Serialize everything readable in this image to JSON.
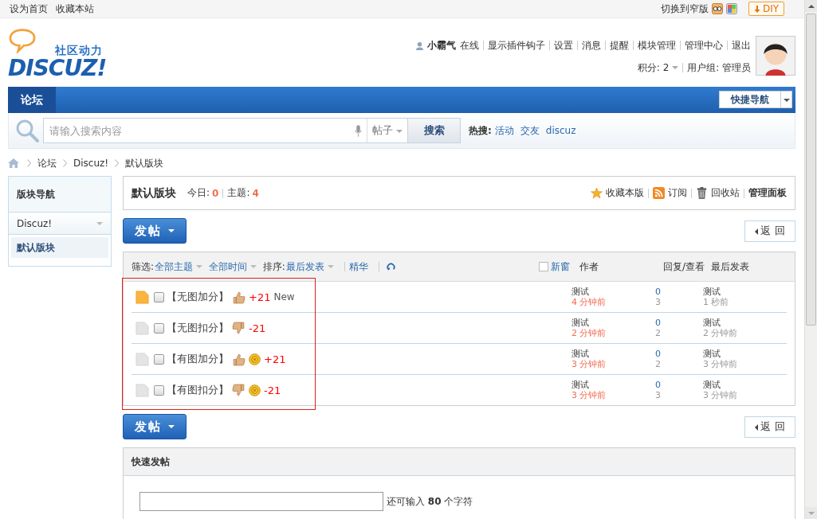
{
  "topbar": {
    "links": [
      "设为首页",
      "收藏本站"
    ],
    "switch_label": "切换到窄版",
    "diy": "DIY"
  },
  "logo": {
    "tagline": "社区动力",
    "wordmark": "DISCUZ!"
  },
  "user": {
    "name": "小霸气",
    "status": "在线",
    "links": [
      "显示插件钩子",
      "设置",
      "消息",
      "提醒",
      "模块管理",
      "管理中心",
      "退出"
    ],
    "points": "积分: 2",
    "group": "用户组: 管理员"
  },
  "nav": {
    "tabs": [
      {
        "label": "论坛",
        "selected": true
      }
    ],
    "quick_nav": "快捷导航"
  },
  "search": {
    "placeholder": "请输入搜索内容",
    "type": "帖子",
    "button": "搜索",
    "hot_label": "热搜:",
    "hot": [
      "活动",
      "交友",
      "discuz"
    ]
  },
  "breadcrumb": [
    "论坛",
    "Discuz!",
    "默认版块"
  ],
  "sidebar": {
    "title": "版块导航",
    "groups": [
      {
        "label": "Discuz!",
        "expanded": true,
        "items": [
          {
            "label": "默认版块",
            "selected": true
          }
        ]
      }
    ]
  },
  "forum": {
    "title": "默认版块",
    "today_label": "今日:",
    "today": "0",
    "topics_label": "主题:",
    "topics": "4",
    "actions": [
      {
        "kind": "star",
        "label": "收藏本版"
      },
      {
        "kind": "rss",
        "label": "订阅"
      },
      {
        "kind": "trash",
        "label": "回收站"
      },
      {
        "kind": "text",
        "label": "管理面板"
      }
    ]
  },
  "toolbars": [
    {
      "post": "发帖",
      "back": "返 回"
    },
    {
      "post": "发帖",
      "back": "返 回"
    }
  ],
  "filter": {
    "label": "筛选:",
    "filters": [
      "全部主题",
      "全部时间"
    ],
    "sort_label": "排序:",
    "sort": "最后发表",
    "digest": "精华",
    "new_window": {
      "label": "新窗",
      "checked": false
    },
    "columns": [
      "作者",
      "回复/查看",
      "最后发表"
    ]
  },
  "threads": [
    {
      "new": true,
      "checked": false,
      "title": "【无图加分】",
      "kind": "up",
      "coin": false,
      "score": "+21",
      "badge": "New",
      "author": "测试",
      "author_time": "4 分钟前",
      "replies": "0",
      "views": "3",
      "last_user": "测试",
      "last_time": "1 秒前"
    },
    {
      "new": false,
      "checked": false,
      "title": "【无图扣分】",
      "kind": "down",
      "coin": false,
      "score": "-21",
      "author": "测试",
      "author_time": "2 分钟前",
      "replies": "0",
      "views": "2",
      "last_user": "测试",
      "last_time": "2 分钟前"
    },
    {
      "new": false,
      "checked": false,
      "title": "【有图加分】",
      "kind": "up",
      "coin": true,
      "score": "+21",
      "author": "测试",
      "author_time": "3 分钟前",
      "replies": "0",
      "views": "2",
      "last_user": "测试",
      "last_time": "3 分钟前"
    },
    {
      "new": false,
      "checked": false,
      "title": "【有图扣分】",
      "kind": "down",
      "coin": true,
      "score": "-21",
      "author": "测试",
      "author_time": "3 分钟前",
      "replies": "0",
      "views": "3",
      "last_user": "测试",
      "last_time": "3 分钟前"
    }
  ],
  "quick_post": {
    "title": "快速发帖",
    "hint": "还可输入 **80** 个字符"
  }
}
